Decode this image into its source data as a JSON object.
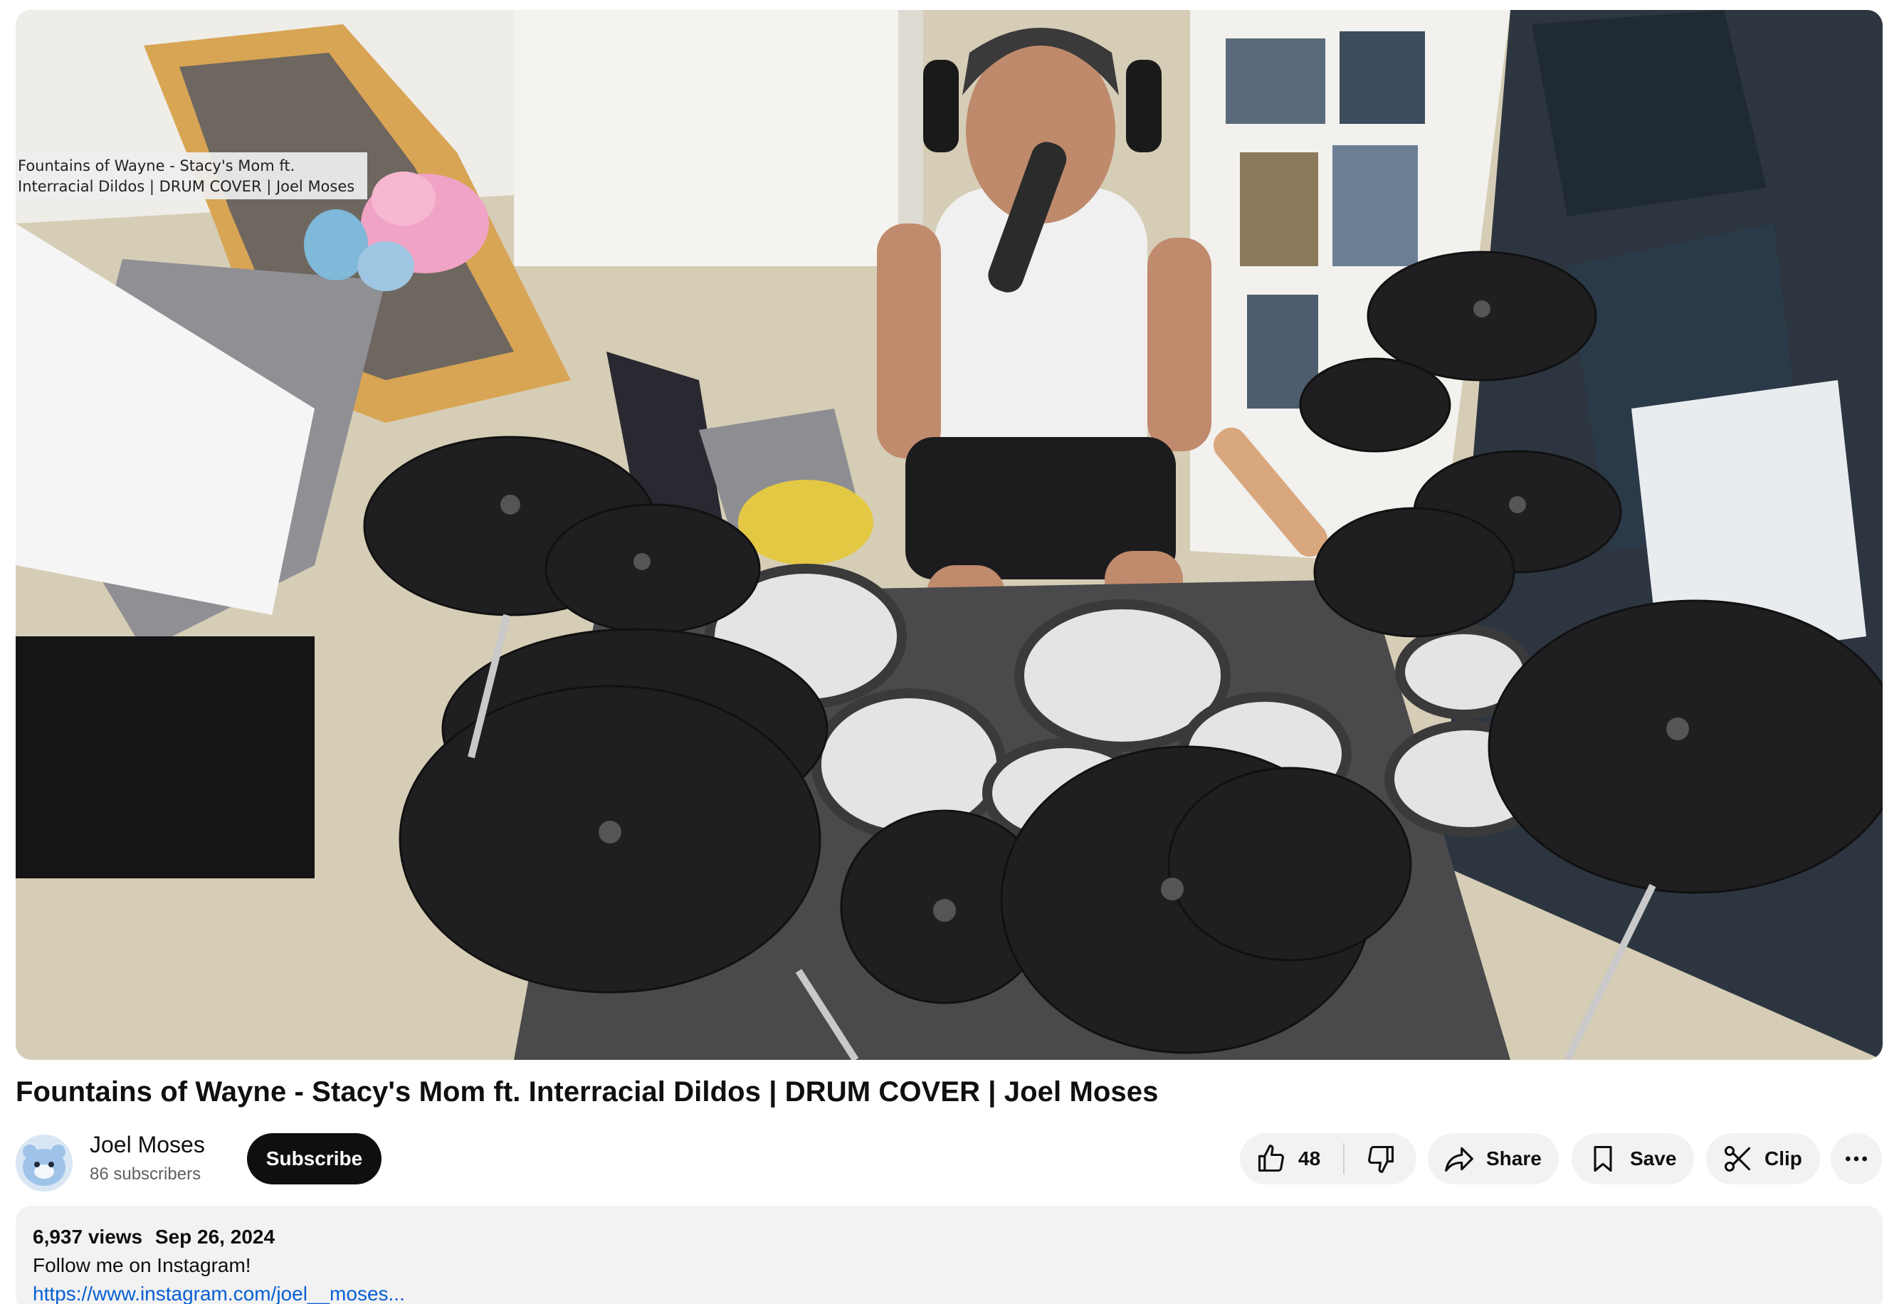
{
  "player": {
    "tooltip": "Fountains of Wayne - Stacy's Mom ft.\nInterracial Dildos | DRUM COVER | Joel Moses"
  },
  "video": {
    "title": "Fountains of Wayne - Stacy's Mom ft. Interracial Dildos | DRUM COVER | Joel Moses"
  },
  "channel": {
    "name": "Joel Moses",
    "subscribers": "86 subscribers",
    "subscribe_label": "Subscribe"
  },
  "actions": {
    "like_count": "48",
    "share_label": "Share",
    "save_label": "Save",
    "clip_label": "Clip"
  },
  "description": {
    "views": "6,937 views",
    "date": "Sep 26, 2024",
    "line1": "Follow me on Instagram!",
    "link": "https://www.instagram.com/joel__moses..."
  },
  "icons": {
    "like": "thumbs-up-icon",
    "dislike": "thumbs-down-icon",
    "share": "share-arrow-icon",
    "save": "bookmark-icon",
    "clip": "scissors-icon",
    "more": "more-horizontal-icon"
  },
  "colors": {
    "link": "#065fd4",
    "subscribe_bg": "#0f0f0f",
    "pill_bg": "#f2f2f2"
  }
}
